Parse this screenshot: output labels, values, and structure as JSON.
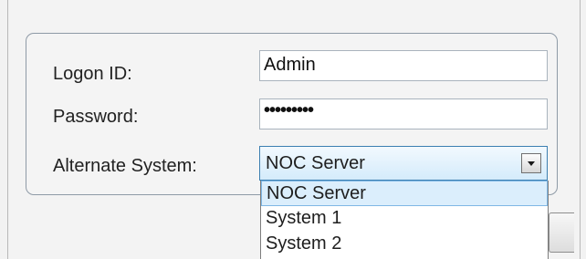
{
  "form": {
    "logon_label": "Logon ID:",
    "logon_value": "Admin",
    "password_label": "Password:",
    "password_value": "•••••••••",
    "alternate_label": "Alternate System:",
    "selected_system": "NOC Server"
  },
  "dropdown": {
    "options": [
      {
        "label": "NOC Server"
      },
      {
        "label": "System 1"
      },
      {
        "label": "System 2"
      }
    ],
    "selected_index": 0
  },
  "colors": {
    "selection_background": "#dbeefc",
    "selection_border": "#7fb7e5",
    "combo_border": "#3c7fb1"
  },
  "icons": {
    "combo_arrow": "chevron-down-icon"
  }
}
